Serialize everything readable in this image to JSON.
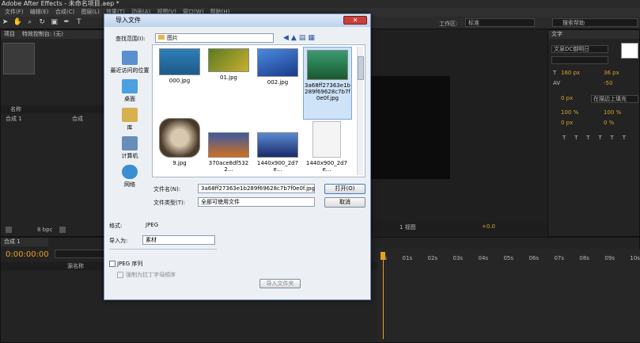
{
  "app": {
    "title": "Adobe After Effects - 未命名项目.aep *"
  },
  "menu": [
    "文件(F)",
    "编辑(E)",
    "合成(C)",
    "图层(L)",
    "效果(T)",
    "动画(A)",
    "视图(V)",
    "窗口(W)",
    "帮助(H)"
  ],
  "toolbar": {
    "workspace_label": "工作区:",
    "workspace_value": "标准",
    "search_placeholder": "搜索帮助"
  },
  "project_panel": {
    "tab": "项目",
    "effects_tab": "特效控制台: (无)",
    "col_name": "名称",
    "item_name": "合成 1",
    "item_type": "合成",
    "bpc": "8 bpc"
  },
  "char_panel": {
    "tab": "文字",
    "font": "文泉DC御明日",
    "size": "160 px",
    "leading": "36 px",
    "tracking": "-50",
    "stroke": "0 px",
    "stroke_mode": "在描边上填充",
    "scale_v": "100 %",
    "scale_h": "100 %",
    "baseline": "0 px",
    "tsume": "0 %"
  },
  "viewer": {
    "zoom": "1 视图",
    "offset": "+0.0"
  },
  "timeline": {
    "tab": "合成 1",
    "timecode": "0:00:00:00",
    "layer_col": "源名称",
    "ticks": [
      "0s",
      "01s",
      "02s",
      "03s",
      "04s",
      "05s",
      "06s",
      "07s",
      "08s",
      "09s",
      "10s"
    ]
  },
  "dialog": {
    "title": "导入文件",
    "close": "✕",
    "lookin_label": "查找范围(I):",
    "lookin_value": "图片",
    "places": [
      {
        "label": "最近访问的位置",
        "color": "#5a8fd0"
      },
      {
        "label": "桌面",
        "color": "#4aa0e0"
      },
      {
        "label": "库",
        "color": "#d8b050"
      },
      {
        "label": "计算机",
        "color": "#6a8db8"
      },
      {
        "label": "网络",
        "color": "#3a8fd0"
      }
    ],
    "files": [
      {
        "name": "000.jpg",
        "c1": "#1e5a8a",
        "c2": "#2d7fb8",
        "w": 52,
        "h": 34
      },
      {
        "name": "01.jpg",
        "c1": "#5a7a20",
        "c2": "#c8b030",
        "w": 52,
        "h": 30
      },
      {
        "name": "002.jpg",
        "c1": "#1a3a8a",
        "c2": "#4a8ae0",
        "w": 52,
        "h": 36
      },
      {
        "name": "3a68ff27363e1b289f69628c7b7f0e0f.jpg",
        "c1": "#1a5a30",
        "c2": "#3a9a70",
        "w": 52,
        "h": 38,
        "selected": true
      },
      {
        "name": "9.jpg",
        "c1": "#4a3a2a",
        "c2": "#d8c8b0",
        "w": 52,
        "h": 50
      },
      {
        "name": "370ace8df5322...",
        "c1": "#d07020",
        "c2": "#3a5aa0",
        "w": 52,
        "h": 32
      },
      {
        "name": "1440x900_2d7e...",
        "c1": "#1a2a6a",
        "c2": "#5a8ad0",
        "w": 52,
        "h": 32
      },
      {
        "name": "1440x900_2d7e...",
        "c1": "#e8e8e8",
        "c2": "#ffffff",
        "w": 36,
        "h": 46,
        "blank": true
      }
    ],
    "filename_label": "文件名(N):",
    "filename_value": "3a68ff27363e1b289f69628c7b7f0e0f.jpg",
    "filetype_label": "文件类型(T):",
    "filetype_value": "全部可使用文件",
    "open_button": "打开(O)",
    "cancel_button": "取消",
    "format_label": "格式:",
    "format_value": "JPEG",
    "import_as_label": "导入为:",
    "import_as_value": "素材",
    "sequence_label": "JPEG 序列",
    "alpha_label": "强制为拉丁字母顺序",
    "import_folder_button": "导入文件夹"
  }
}
